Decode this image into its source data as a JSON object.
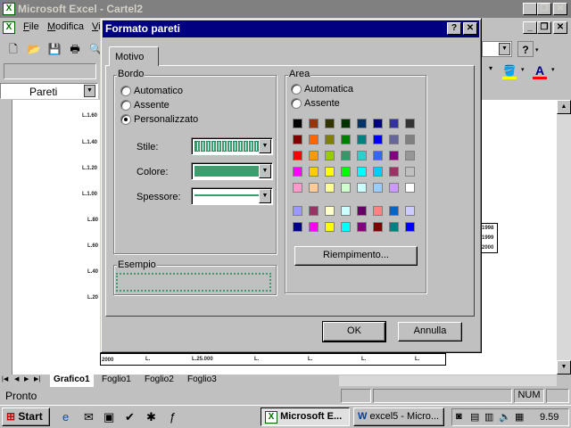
{
  "window": {
    "title": "Microsoft Excel - Cartel2"
  },
  "menu": {
    "items": [
      "File",
      "Modifica",
      "Vi"
    ]
  },
  "namebox": {
    "value": "Pareti"
  },
  "chart": {
    "y_labels": [
      "L.1.60",
      "L.1.40",
      "L.1.20",
      "L.1.00",
      "L.80",
      "L.60",
      "L.40",
      "L.20"
    ],
    "legend": [
      "1998",
      "1999",
      "2000"
    ],
    "table_row": {
      "year": "2000",
      "cells": [
        "L.",
        "L.25.000",
        "L.",
        "L.",
        "L.",
        "L."
      ]
    }
  },
  "dialog": {
    "title": "Formato pareti",
    "help_button": "?",
    "close_button": "✕",
    "tab": "Motivo",
    "border": {
      "label": "Bordo",
      "options": [
        "Automatico",
        "Assente",
        "Personalizzato"
      ],
      "selected": "Personalizzato",
      "style_label": "Stile:",
      "color_label": "Colore:",
      "weight_label": "Spessore:",
      "color_value": "#3c9e6e"
    },
    "area": {
      "label": "Area",
      "options": [
        "Automatica",
        "Assente"
      ],
      "palette": [
        [
          "#000000",
          "#993300",
          "#333300",
          "#003300",
          "#003366",
          "#000080",
          "#333399",
          "#333333"
        ],
        [
          "#800000",
          "#ff6600",
          "#808000",
          "#008000",
          "#008080",
          "#0000ff",
          "#666699",
          "#808080"
        ],
        [
          "#ff0000",
          "#ff9900",
          "#99cc00",
          "#339966",
          "#33cccc",
          "#3366ff",
          "#800080",
          "#969696"
        ],
        [
          "#ff00ff",
          "#ffcc00",
          "#ffff00",
          "#00ff00",
          "#00ffff",
          "#00ccff",
          "#993366",
          "#c0c0c0"
        ],
        [
          "#ff99cc",
          "#ffcc99",
          "#ffff99",
          "#ccffcc",
          "#ccffff",
          "#99ccff",
          "#cc99ff",
          "#ffffff"
        ]
      ],
      "chart_palette": [
        [
          "#9999ff",
          "#993366",
          "#ffffcc",
          "#ccffff",
          "#660066",
          "#ff8080",
          "#0066cc",
          "#ccccff"
        ],
        [
          "#000080",
          "#ff00ff",
          "#ffff00",
          "#00ffff",
          "#800080",
          "#800000",
          "#008080",
          "#0000ff"
        ]
      ],
      "fill_button": "Riempimento..."
    },
    "sample": {
      "label": "Esempio"
    },
    "ok_button": "OK",
    "cancel_button": "Annulla"
  },
  "sheet_tabs": [
    "Grafico1",
    "Foglio1",
    "Foglio2",
    "Foglio3"
  ],
  "status": {
    "text": "Pronto",
    "num": "NUM"
  },
  "taskbar": {
    "start": "Start",
    "tasks": [
      "Microsoft E...",
      "excel5 - Micro..."
    ],
    "clock": "9.59"
  }
}
